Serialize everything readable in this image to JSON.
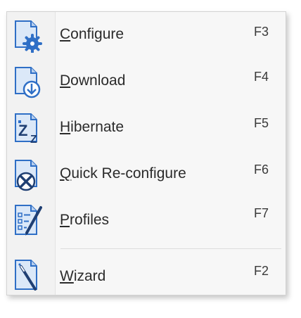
{
  "menu": {
    "items": [
      {
        "accel": "C",
        "rest": "onfigure",
        "shortcut": "F3",
        "icon": "configure-gear-icon"
      },
      {
        "accel": "D",
        "rest": "ownload",
        "shortcut": "F4",
        "icon": "download-arrow-icon"
      },
      {
        "accel": "H",
        "rest": "ibernate",
        "shortcut": "F5",
        "icon": "hibernate-zz-icon"
      },
      {
        "accel": "Q",
        "rest": "uick Re-configure",
        "shortcut": "F6",
        "icon": "quick-reconfigure-tools-icon"
      },
      {
        "accel": "P",
        "rest": "rofiles",
        "shortcut": "F7",
        "icon": "profiles-checklist-icon"
      },
      {
        "accel": "W",
        "rest": "izard",
        "shortcut": "F2",
        "icon": "wizard-wand-icon"
      }
    ]
  },
  "colors": {
    "icon_blue": "#2f6fc6",
    "icon_light": "#dbe8f8",
    "icon_dark": "#1f3f73"
  }
}
